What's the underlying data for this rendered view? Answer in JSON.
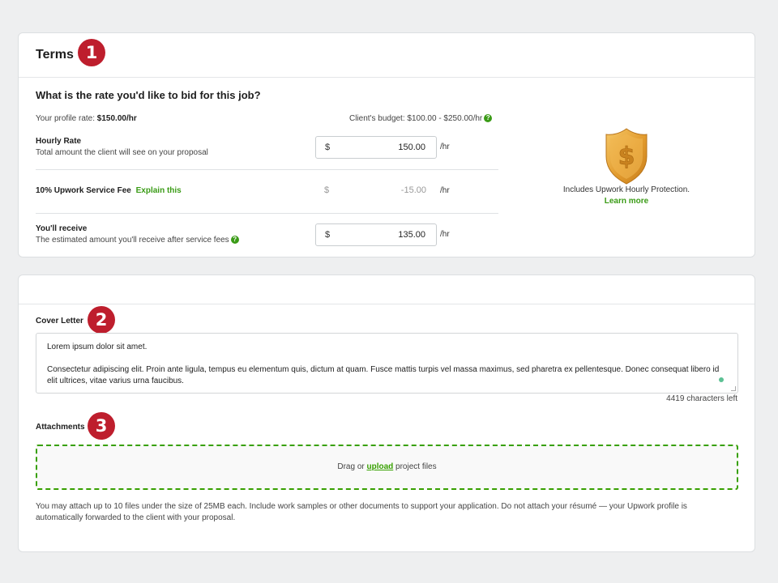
{
  "terms": {
    "title": "Terms",
    "badge": "1",
    "question": "What is the rate you'd like to bid for this job?",
    "profile_rate_label": "Your profile rate: ",
    "profile_rate_value": "$150.00/hr",
    "client_budget": "Client's budget: $100.00 - $250.00/hr",
    "hourly_rate": {
      "label": "Hourly Rate",
      "description": "Total amount the client will see on your proposal",
      "currency": "$",
      "value": "150.00",
      "unit": "/hr"
    },
    "service_fee": {
      "label": "10% Upwork Service Fee",
      "link": "Explain this",
      "currency": "$",
      "value": "-15.00",
      "unit": "/hr"
    },
    "receive": {
      "label": "You'll receive",
      "description": "The estimated amount you'll receive after service fees",
      "currency": "$",
      "value": "135.00",
      "unit": "/hr"
    },
    "protection": {
      "text": "Includes Upwork Hourly Protection.",
      "link": "Learn more",
      "icon": "shield-dollar-icon"
    },
    "help_icon": "?"
  },
  "cover": {
    "label": "Cover Letter",
    "badge": "2",
    "text_line1": "Lorem ipsum dolor sit amet.",
    "text_para2": "Consectetur adipiscing elit. Proin ante ligula, tempus eu elementum quis, dictum at quam. Fusce mattis turpis vel massa maximus, sed pharetra ex pellentesque. Donec consequat libero id elit ultrices, vitae varius urna faucibus.",
    "chars_left": "4419 characters left"
  },
  "attachments": {
    "label": "Attachments",
    "badge": "3",
    "drop_prefix": "Drag or ",
    "drop_link": "upload",
    "drop_suffix": " project files",
    "note": "You may attach up to 10 files under the size of 25MB each. Include work samples or other documents to support your application. Do not attach your résumé — your Upwork profile is automatically forwarded to the client with your proposal."
  },
  "colors": {
    "accent_green": "#37a000",
    "badge_red": "#be1e2d",
    "shield_gold": "#e8a93b"
  }
}
